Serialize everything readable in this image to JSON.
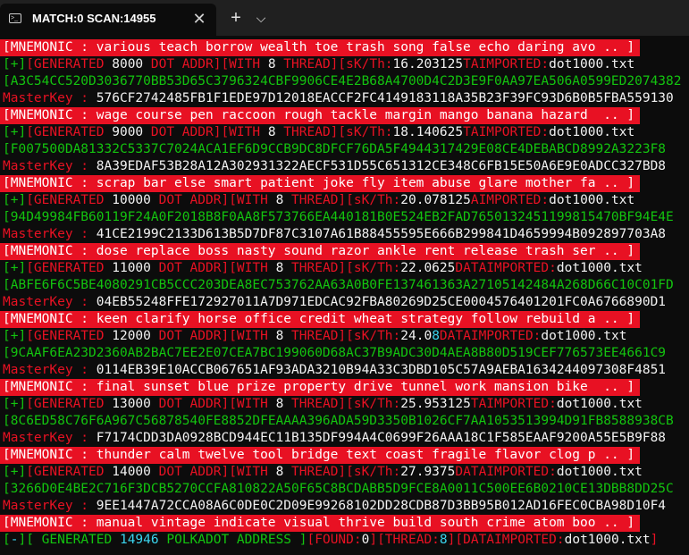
{
  "window": {
    "tab_title": "MATCH:0 SCAN:14955",
    "tab_icon": "terminal-icon",
    "close_icon": "close-icon",
    "new_tab_icon": "plus-icon",
    "dropdown_icon": "chevron-down-icon"
  },
  "colors": {
    "red": "#e81123",
    "green": "#13c40f",
    "white": "#f2f2f2",
    "cyan": "#3ad4ee",
    "background": "#0c0c0c"
  },
  "console": {
    "blocks": [
      {
        "mnemonic": "[MNEMONIC : various teach borrow wealth toe trash song false echo daring avo .. ]",
        "gen_count": "8000",
        "threads": "8",
        "speed": "16.203125",
        "import_label": "TAIMPORTED:",
        "import_file": "dot1000.txt",
        "address": "A3C54CC520D3036770BB53D65C3796324CBF9906CE4E2B68A4700D4C2D3E9F0AA97EA506A0599ED2074382",
        "master_key": "576CF2742485FB1F1EDE97D12018EACCF2FC4149183118A35B23F39FC93D6B0B5FBA559130"
      },
      {
        "mnemonic": "[MNEMONIC : wage course pen raccoon rough tackle margin mango banana hazard  .. ]",
        "gen_count": "9000",
        "threads": "8",
        "speed": "18.140625",
        "import_label": "TAIMPORTED:",
        "import_file": "dot1000.txt",
        "address": "F007500DA81332C5337C7024ACA1EF6D9CCB9DC8DFCF76DA5F4944317429E08CE4DEBABCD8992A3223F8",
        "master_key": "8A39EDAF53B28A12A302931322AECF531D55C651312CE348C6FB15E50A6E9E0ADCC327BD8"
      },
      {
        "mnemonic": "[MNEMONIC : scrap bar else smart patient joke fly item abuse glare mother fa .. ]",
        "gen_count": "10000",
        "threads": "8",
        "speed": "20.078125",
        "import_label": "AIMPORTED:",
        "import_file": "dot1000.txt",
        "address": "94D49984FB60119F24A0F2018B8F0AA8F573766EA440181B0E524EB2FAD7650132451199815470BF94E4E",
        "master_key": "41CE2199C2133D613B5D7DF87C3107A61B88455595E666B299841D4659994B092897703A8"
      },
      {
        "mnemonic": "[MNEMONIC : dose replace boss nasty sound razor ankle rent release trash ser .. ]",
        "gen_count": "11000",
        "threads": "8",
        "speed": "22.0625",
        "import_label": "DATAIMPORTED:",
        "import_file": "dot1000.txt",
        "address": "ABFE6F6C5BE4080291CB5CCC203DEA8EC753762AA63A0B0FE137461363A27105142484A268D66C10C01FD",
        "master_key": "04EB55248FFE172927011A7D971EDCAC92FBA80269D25CE0004576401201FC0A6766890D1"
      },
      {
        "mnemonic": "[MNEMONIC : keen clarify horse office credit wheat strategy follow rebuild a .. ]",
        "gen_count": "12000",
        "threads": "8",
        "speed": "24.0",
        "speed_extra": "8",
        "import_label": "DATAIMPORTED:",
        "import_file": "dot1000.txt",
        "address": "9CAAF6EA23D2360AB2BAC7EE2E07CEA7BC199060D68AC37B9ADC30D4AEA8B80D519CEF776573EE4661C9",
        "master_key": "0114EB39E10ACCB067651AF93ADA3210B94A33C3DBD105C57A9AEBA1634244097308F4851"
      },
      {
        "mnemonic": "[MNEMONIC : final sunset blue prize property drive tunnel work mansion bike  .. ]",
        "gen_count": "13000",
        "threads": "8",
        "speed": "25.953125",
        "import_label": "TAIMPORTED:",
        "import_file": "dot1000.txt",
        "address": "8C6ED58C76F6A967C56878540FE8852DFEAAAA396ADA59D3350B1026CF7AA1053513994D91FB8588938CB",
        "master_key": "F7174CDD3DA0928BCD944EC11B135DF994A4C0699F26AAA18C1F585EAAF9200A55E5B9F88"
      },
      {
        "mnemonic": "[MNEMONIC : thunder calm twelve tool bridge text coast fragile flavor clog p .. ]",
        "gen_count": "14000",
        "threads": "8",
        "speed": "27.9375",
        "import_label": "DATAIMPORTED:",
        "import_file": "dot1000.txt",
        "address": "3266D0E4BE2C716F3DCB5270CCFA810822A50F65C8BCDABB5D9FCE8A0011C500EE6B0210CE13DBB8DD25C",
        "master_key": "9EE1447A72CCA08A6C0DE0C2D09E99268102DD28CDB87D3BB95B012AD16FEC0CBA98D10F4"
      }
    ],
    "final_mnemonic": "[MNEMONIC : manual vintage indicate visual thrive build south crime atom boo .. ]",
    "labels": {
      "plus": "+",
      "generated": "[GENERATED ",
      "dot_addr": " DOT ADDR][WITH ",
      "thread": " THREAD][sK/Th:",
      "master_key": "MasterKey : "
    },
    "status": {
      "prefix": "-",
      "generated_label": " GENERATED ",
      "count": "14946",
      "address_label": " POLKADOT ADDRESS ",
      "found_label": "[FOUND:",
      "found_value": "0",
      "thread_label": "[THREAD:",
      "thread_value": "8",
      "import_label": "[DATAIMPORTED:",
      "import_file": "dot1000.txt"
    }
  }
}
